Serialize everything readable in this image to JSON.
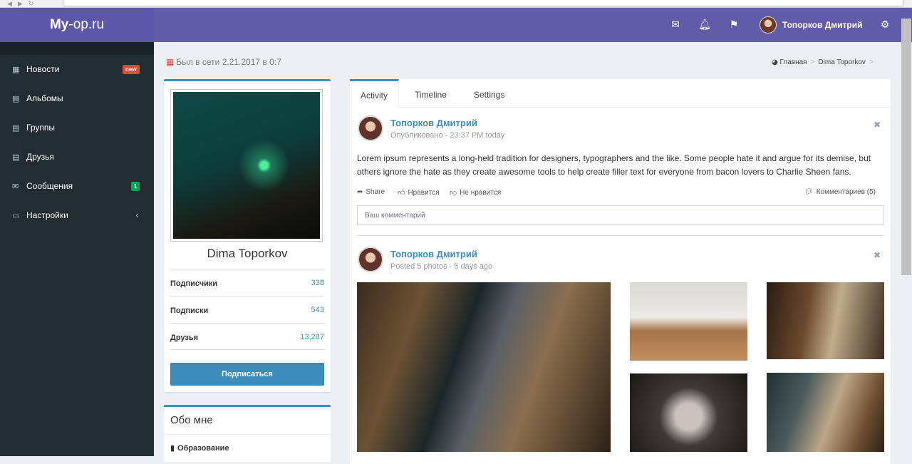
{
  "brand": {
    "logo_bold": "My",
    "logo_rest": "-op.ru"
  },
  "header": {
    "user_name": "Топорков Дмитрий",
    "icons": [
      "mail-icon",
      "bell-icon",
      "flag-icon",
      "gears-icon"
    ]
  },
  "sidebar": {
    "items": [
      {
        "label": "Новости",
        "icon": "th-icon",
        "badge": "new"
      },
      {
        "label": "Альбомы",
        "icon": "calendar-icon"
      },
      {
        "label": "Группы",
        "icon": "calendar-icon"
      },
      {
        "label": "Друзья",
        "icon": "calendar-icon"
      },
      {
        "label": "Сообщения",
        "icon": "envelope-icon",
        "badge": "1"
      },
      {
        "label": "Настройки",
        "icon": "laptop-icon"
      }
    ]
  },
  "status_text": "Был в сети 2.21.2017 в 0:7",
  "breadcrumb": {
    "home": "Главная",
    "current": "Dima Toporkov"
  },
  "profile": {
    "name": "Dima Toporkov",
    "stats": [
      {
        "label": "Подписчики",
        "value": "338"
      },
      {
        "label": "Подписки",
        "value": "543"
      },
      {
        "label": "Друзья",
        "value": "13,287"
      }
    ],
    "follow_label": "Подписаться"
  },
  "about": {
    "title": "Обо мне",
    "education": "Образование"
  },
  "tabs": [
    "Activity",
    "Timeline",
    "Settings"
  ],
  "posts": [
    {
      "author": "Топорков Дмитрий",
      "meta": "Опубликовано - 23:37 PM today",
      "body": "Lorem ipsum represents a long-held tradition for designers, typographers and the like. Some people hate it and argue for its demise, but others ignore the hate as they create awesome tools to help create filler text for everyone from bacon lovers to Charlie Sheen fans.",
      "share": "Share",
      "like": "Нравится",
      "dislike": "Не нравится",
      "comments": "Комментариев (5)",
      "comment_placeholder": "Ваш комментарий"
    },
    {
      "author": "Топорков Дмитрий",
      "meta": "Posted 5 photos - 5 days ago"
    }
  ],
  "colors": {
    "header": "#605ca8",
    "sidebar": "#222d32",
    "accent": "#3c8dbc",
    "badge_new": "#dd4b39",
    "badge_msg": "#00a65a"
  }
}
